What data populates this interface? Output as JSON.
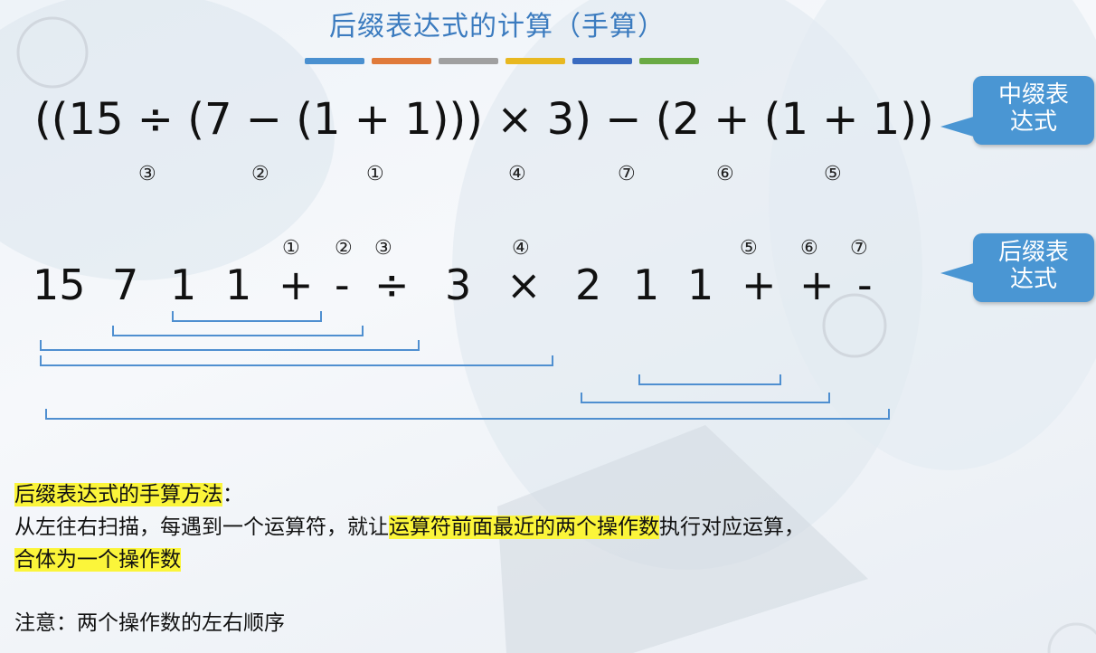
{
  "title": "后缀表达式的计算（手算）",
  "color_strip": [
    "#4a90d0",
    "#e07a3a",
    "#a0a0a0",
    "#e8b820",
    "#3a6bc0",
    "#6aaa44"
  ],
  "infix": {
    "expression": "((15 ÷ (7 − (1 + 1))) × 3) − (2 + (1 + 1))",
    "order_marks": [
      "③",
      "②",
      "①",
      "④",
      "⑦",
      "⑥",
      "⑤"
    ]
  },
  "postfix": {
    "tokens": [
      "15",
      "7",
      "1",
      "1",
      "+",
      "-",
      "÷",
      "3",
      "×",
      "2",
      "1",
      "1",
      "+",
      "+",
      "-"
    ],
    "order_marks": [
      "①",
      "②",
      "③",
      "④",
      "⑤",
      "⑥",
      "⑦"
    ]
  },
  "callouts": {
    "infix_label": "中缀表\n达式",
    "postfix_label": "后缀表\n达式"
  },
  "method": {
    "heading": "后缀表达式的手算方法",
    "heading_colon": "：",
    "line1_a": "从左往右扫描，每遇到一个运算符，就让",
    "line1_hl": "运算符前面最近的两个操作数",
    "line1_b": "执行对应运算，",
    "line2_hl": "合体为一个操作数",
    "note": "注意：两个操作数的左右顺序"
  }
}
